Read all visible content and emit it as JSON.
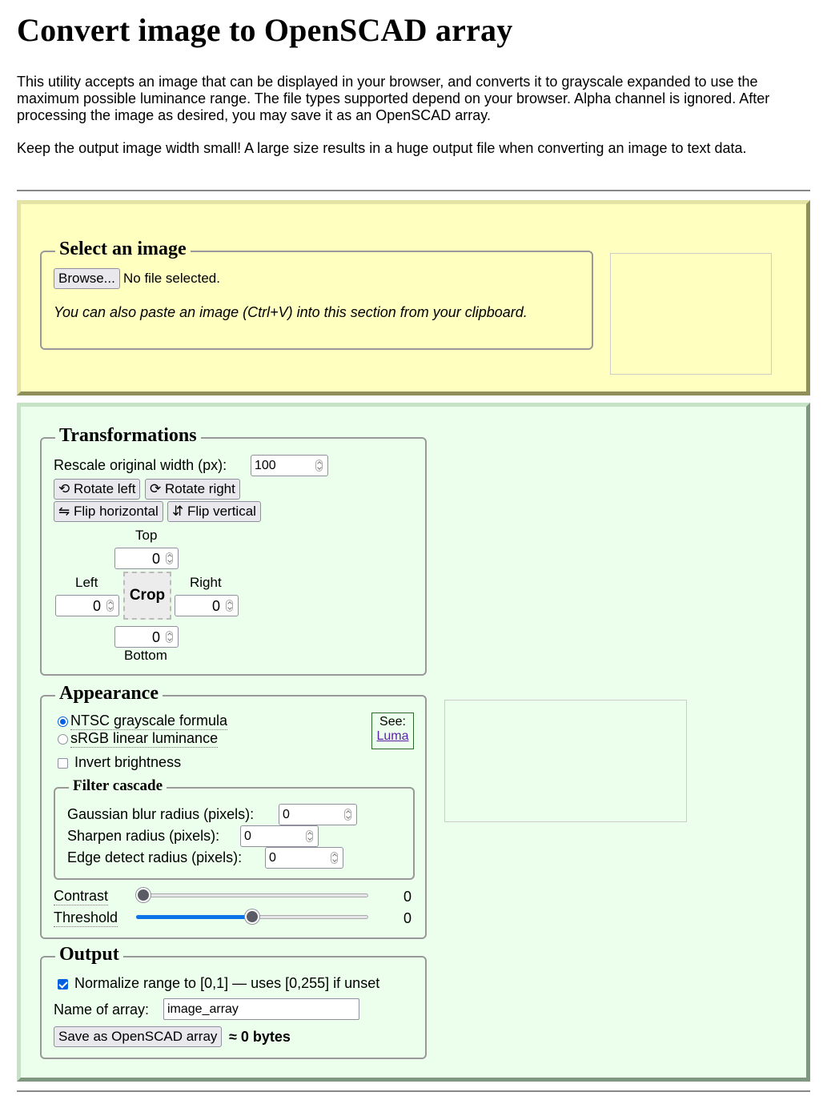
{
  "page": {
    "title": "Convert image to OpenSCAD array",
    "intro_1": "This utility accepts an image that can be displayed in your browser, and converts it to grayscale expanded to use the maximum possible luminance range. The file types supported depend on your browser. Alpha channel is ignored. After processing the image as desired, you may save it as an OpenSCAD array.",
    "intro_2": "Keep the output image width small! A large size results in a huge output file when converting an image to text data."
  },
  "select": {
    "legend": "Select an image",
    "browse_label": "Browse...",
    "file_status": "No file selected.",
    "paste_hint": "You can also paste an image (Ctrl+V) into this section from your clipboard."
  },
  "transform": {
    "legend": "Transformations",
    "rescale_label": "Rescale original width (px):",
    "rescale_value": "100",
    "rotate_left": "⟲ Rotate left",
    "rotate_right": "⟳ Rotate right",
    "flip_h": "⇋ Flip horizontal",
    "flip_v": "⇵ Flip vertical",
    "crop": {
      "top_label": "Top",
      "top_value": "0",
      "left_label": "Left",
      "left_value": "0",
      "right_label": "Right",
      "right_value": "0",
      "bottom_label": "Bottom",
      "bottom_value": "0",
      "button_label": "Crop"
    }
  },
  "appearance": {
    "legend": "Appearance",
    "radio_ntsc": "NTSC grayscale formula",
    "radio_srgb": "sRGB linear luminance",
    "selected": "NTSC grayscale formula",
    "see_label": "See:",
    "see_link": "Luma",
    "invert_label": "Invert brightness",
    "invert_checked": false,
    "filter": {
      "legend": "Filter cascade",
      "gauss_label": "Gaussian blur radius (pixels):",
      "gauss_value": "0",
      "sharpen_label": "Sharpen radius (pixels):",
      "sharpen_value": "0",
      "edge_label": "Edge detect radius (pixels):",
      "edge_value": "0"
    },
    "contrast_label": "Contrast",
    "contrast_value": "0",
    "contrast_slider_fraction": 0.0,
    "threshold_label": "Threshold",
    "threshold_value": "0",
    "threshold_slider_fraction": 0.5
  },
  "output": {
    "legend": "Output",
    "normalize_label": "Normalize range to [0,1] — uses [0,255] if unset",
    "normalize_checked": true,
    "name_label": "Name of array:",
    "name_value": "image_array",
    "save_label": "Save as OpenSCAD array",
    "size_text": "≈ 0 bytes"
  },
  "colors": {
    "select_panel_bg": "#ffffc0",
    "transform_panel_bg": "#ecffec",
    "accent": "#0060df"
  }
}
